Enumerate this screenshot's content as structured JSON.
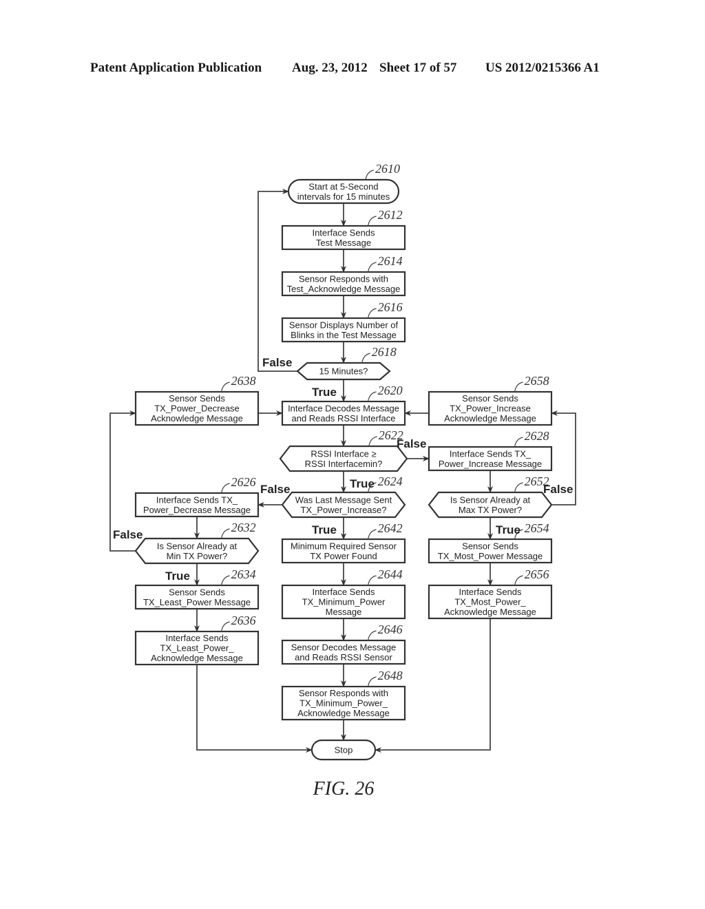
{
  "header": {
    "publication": "Patent Application Publication",
    "date": "Aug. 23, 2012",
    "sheet": "Sheet 17 of 57",
    "number": "US 2012/0215366 A1"
  },
  "figure_label": "FIG. 26",
  "nodes": {
    "n2610": {
      "ref": "2610",
      "type": "terminal",
      "lines": [
        "Start at 5-Second",
        "intervals for 15 minutes"
      ]
    },
    "n2612": {
      "ref": "2612",
      "type": "process",
      "lines": [
        "Interface Sends",
        "Test Message"
      ]
    },
    "n2614": {
      "ref": "2614",
      "type": "process",
      "lines": [
        "Sensor Responds with",
        "Test_Acknowledge Message"
      ]
    },
    "n2616": {
      "ref": "2616",
      "type": "process",
      "lines": [
        "Sensor Displays Number of",
        "Blinks in the Test Message"
      ]
    },
    "n2618": {
      "ref": "2618",
      "type": "decision",
      "lines": [
        "15 Minutes?"
      ]
    },
    "n2620": {
      "ref": "2620",
      "type": "process",
      "lines": [
        "Interface Decodes Message",
        "and Reads RSSI Interface"
      ]
    },
    "n2638": {
      "ref": "2638",
      "type": "process",
      "lines": [
        "Sensor Sends",
        "TX_Power_Decrease",
        "Acknowledge Message"
      ]
    },
    "n2658": {
      "ref": "2658",
      "type": "process",
      "lines": [
        "Sensor Sends",
        "TX_Power_Increase",
        "Acknowledge Message"
      ]
    },
    "n2622": {
      "ref": "2622",
      "type": "decision",
      "lines": [
        "RSSI Interface ≥",
        "RSSI Interfacemin?"
      ]
    },
    "n2628": {
      "ref": "2628",
      "type": "process",
      "lines": [
        "Interface Sends TX_",
        "Power_Increase Message"
      ]
    },
    "n2626": {
      "ref": "2626",
      "type": "process",
      "lines": [
        "Interface Sends TX_",
        "Power_Decrease Message"
      ]
    },
    "n2624": {
      "ref": "2624",
      "type": "decision",
      "lines": [
        "Was Last Message Sent",
        "TX_Power_Increase?"
      ]
    },
    "n2652": {
      "ref": "2652",
      "type": "decision",
      "lines": [
        "Is Sensor Already at",
        "Max TX Power?"
      ]
    },
    "n2632": {
      "ref": "2632",
      "type": "decision",
      "lines": [
        "Is Sensor Already at",
        "Min TX Power?"
      ]
    },
    "n2642": {
      "ref": "2642",
      "type": "process",
      "lines": [
        "Minimum Required Sensor",
        "TX Power Found"
      ]
    },
    "n2654": {
      "ref": "2654",
      "type": "process",
      "lines": [
        "Sensor Sends",
        "TX_Most_Power Message"
      ]
    },
    "n2634": {
      "ref": "2634",
      "type": "process",
      "lines": [
        "Sensor Sends",
        "TX_Least_Power Message"
      ]
    },
    "n2644": {
      "ref": "2644",
      "type": "process",
      "lines": [
        "Interface Sends",
        "TX_Minimum_Power",
        "Message"
      ]
    },
    "n2656": {
      "ref": "2656",
      "type": "process",
      "lines": [
        "Interface Sends",
        "TX_Most_Power_",
        "Acknowledge Message"
      ]
    },
    "n2636": {
      "ref": "2636",
      "type": "process",
      "lines": [
        "Interface Sends",
        "TX_Least_Power_",
        "Acknowledge Message"
      ]
    },
    "n2646": {
      "ref": "2646",
      "type": "process",
      "lines": [
        "Sensor Decodes Message",
        "and Reads RSSI Sensor"
      ]
    },
    "n2648": {
      "ref": "2648",
      "type": "process",
      "lines": [
        "Sensor Responds with",
        "TX_Minimum_Power_",
        "Acknowledge Message"
      ]
    },
    "stop": {
      "ref": "",
      "type": "terminal",
      "lines": [
        "Stop"
      ]
    }
  },
  "edges": [
    {
      "from": "n2610",
      "to": "n2612",
      "label": ""
    },
    {
      "from": "n2612",
      "to": "n2614",
      "label": ""
    },
    {
      "from": "n2614",
      "to": "n2616",
      "label": ""
    },
    {
      "from": "n2616",
      "to": "n2618",
      "label": ""
    },
    {
      "from": "n2618",
      "to": "n2610",
      "label": "False"
    },
    {
      "from": "n2618",
      "to": "n2620",
      "label": "True"
    },
    {
      "from": "n2638",
      "to": "n2620",
      "label": ""
    },
    {
      "from": "n2658",
      "to": "n2620",
      "label": ""
    },
    {
      "from": "n2620",
      "to": "n2622",
      "label": ""
    },
    {
      "from": "n2622",
      "to": "n2628",
      "label": "False"
    },
    {
      "from": "n2622",
      "to": "n2624",
      "label": "True"
    },
    {
      "from": "n2624",
      "to": "n2626",
      "label": "False"
    },
    {
      "from": "n2624",
      "to": "n2642",
      "label": "True"
    },
    {
      "from": "n2628",
      "to": "n2652",
      "label": ""
    },
    {
      "from": "n2652",
      "to": "n2658",
      "label": "False"
    },
    {
      "from": "n2652",
      "to": "n2654",
      "label": "True"
    },
    {
      "from": "n2626",
      "to": "n2632",
      "label": ""
    },
    {
      "from": "n2632",
      "to": "n2638",
      "label": "False"
    },
    {
      "from": "n2632",
      "to": "n2634",
      "label": "True"
    },
    {
      "from": "n2642",
      "to": "n2644",
      "label": ""
    },
    {
      "from": "n2644",
      "to": "n2646",
      "label": ""
    },
    {
      "from": "n2646",
      "to": "n2648",
      "label": ""
    },
    {
      "from": "n2648",
      "to": "stop",
      "label": ""
    },
    {
      "from": "n2634",
      "to": "n2636",
      "label": ""
    },
    {
      "from": "n2636",
      "to": "stop",
      "label": ""
    },
    {
      "from": "n2654",
      "to": "n2656",
      "label": ""
    },
    {
      "from": "n2656",
      "to": "stop",
      "label": ""
    }
  ]
}
